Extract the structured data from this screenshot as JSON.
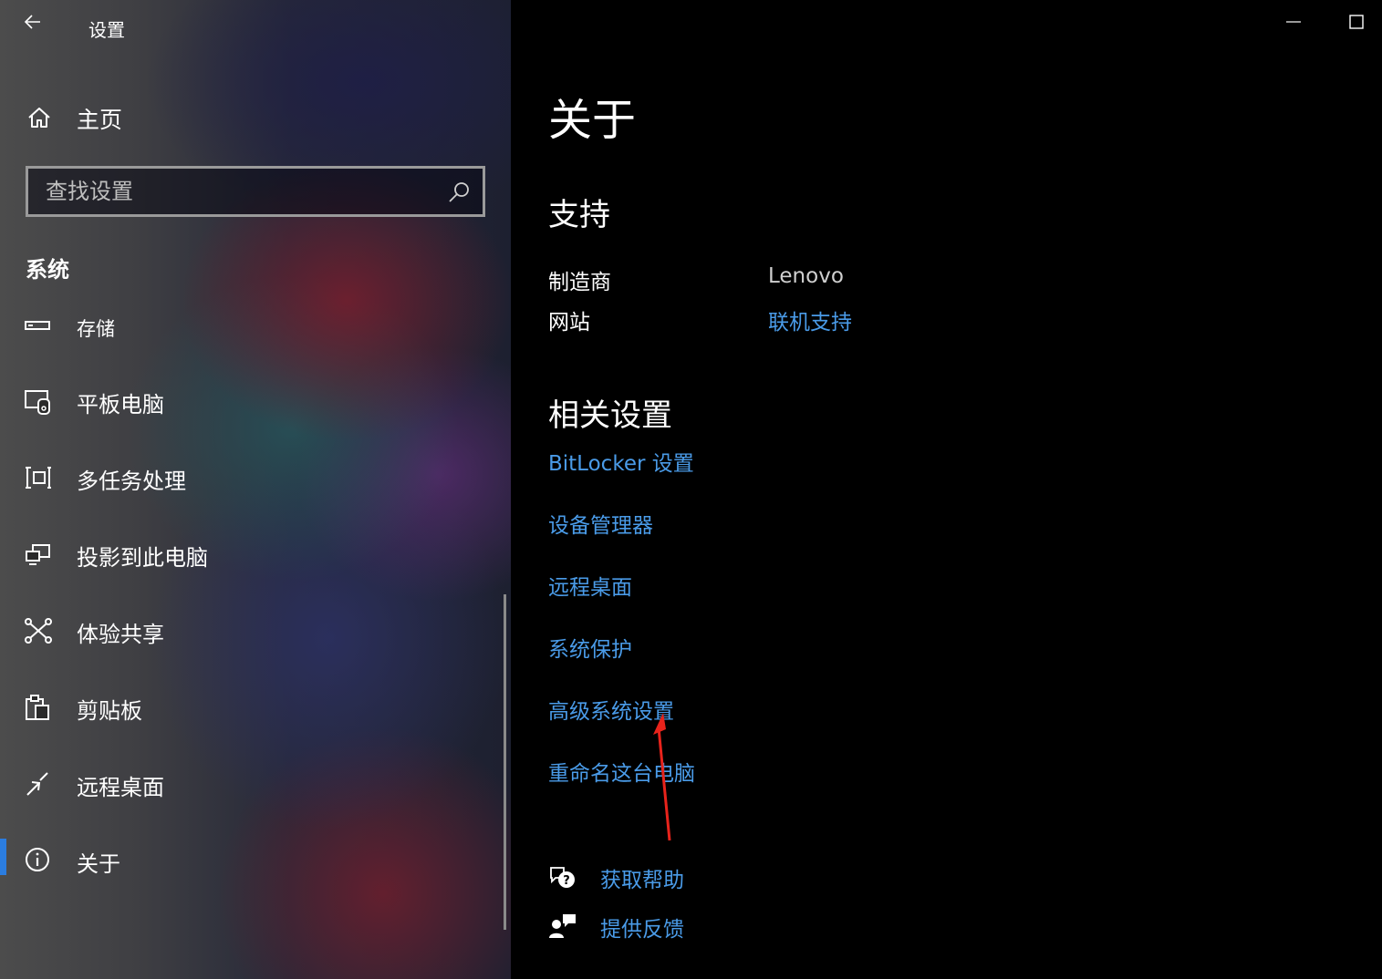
{
  "window": {
    "title": "设置"
  },
  "sidebar": {
    "home_label": "主页",
    "search_placeholder": "查找设置",
    "section_title": "系统",
    "items": [
      {
        "label": "存储",
        "icon": "storage-icon"
      },
      {
        "label": "平板电脑",
        "icon": "tablet-icon"
      },
      {
        "label": "多任务处理",
        "icon": "multitasking-icon"
      },
      {
        "label": "投影到此电脑",
        "icon": "project-icon"
      },
      {
        "label": "体验共享",
        "icon": "share-icon"
      },
      {
        "label": "剪贴板",
        "icon": "clipboard-icon"
      },
      {
        "label": "远程桌面",
        "icon": "remote-desktop-icon"
      },
      {
        "label": "关于",
        "icon": "info-icon",
        "active": true
      }
    ]
  },
  "main": {
    "page_title": "关于",
    "support": {
      "heading": "支持",
      "manufacturer_label": "制造商",
      "manufacturer_value": "Lenovo",
      "website_label": "网站",
      "website_link": "联机支持"
    },
    "related": {
      "heading": "相关设置",
      "links": [
        "BitLocker 设置",
        "设备管理器",
        "远程桌面",
        "系统保护",
        "高级系统设置",
        "重命名这台电脑"
      ]
    },
    "help": {
      "get_help": "获取帮助",
      "feedback": "提供反馈"
    }
  },
  "colors": {
    "accent": "#2b7de0",
    "link": "#4a9be8",
    "annotation_arrow": "#e8231b"
  }
}
